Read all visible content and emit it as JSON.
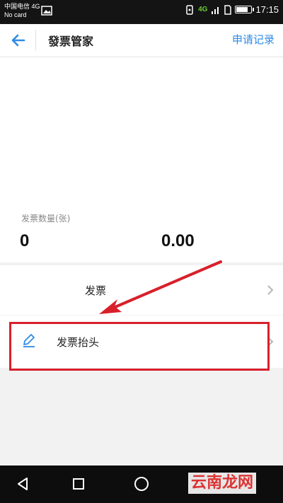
{
  "status_bar": {
    "carrier_line1": "中国电信 4G",
    "carrier_line2": "No card",
    "network": "4G",
    "time": "17:15",
    "battery_level": 0.8
  },
  "header": {
    "title": "發票管家",
    "action_label": "申请记录"
  },
  "summary": {
    "count_label": "发票数量(张)",
    "count_value": "0",
    "amount_value": "0.00"
  },
  "menu": {
    "invoice_label": "发票",
    "invoice_title_label": "发票抬头"
  },
  "watermark": "云南龙网",
  "colors": {
    "accent": "#2e8ae6",
    "highlight": "#d8202a",
    "status_bar": "#141414",
    "nav_bar": "#0d0d0d",
    "network": "#66cc33"
  },
  "icons": {
    "back": "arrow-left-icon",
    "chevron": "chevron-right-icon",
    "pencil": "pencil-icon"
  }
}
